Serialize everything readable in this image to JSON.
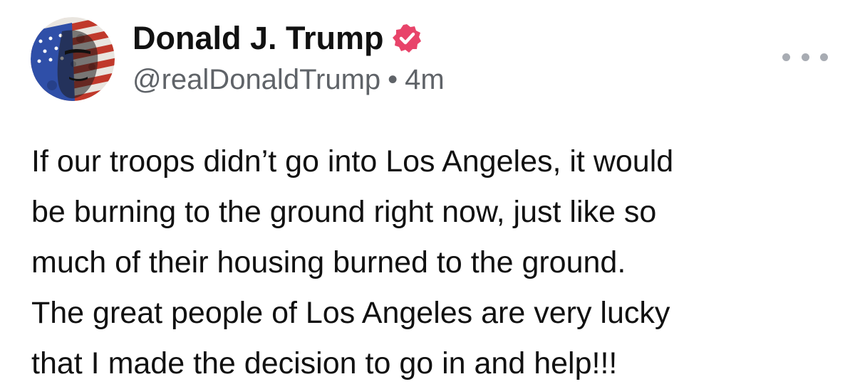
{
  "post": {
    "author": {
      "display_name": "Donald J. Trump",
      "handle": "@realDonaldTrump",
      "verified": true,
      "verified_badge_color": "#e8446a",
      "avatar_icon": "flag-portrait-avatar"
    },
    "separator": "•",
    "timestamp": "4m",
    "more_menu_icon": "more-horizontal-icon",
    "body_lines": [
      "If our troops didn’t go into Los Angeles, it would",
      "be burning to the ground right now, just like so",
      "much of their housing burned to the ground.",
      "The great people of Los Angeles are very lucky",
      "that I made the decision to go in and help!!!"
    ]
  }
}
